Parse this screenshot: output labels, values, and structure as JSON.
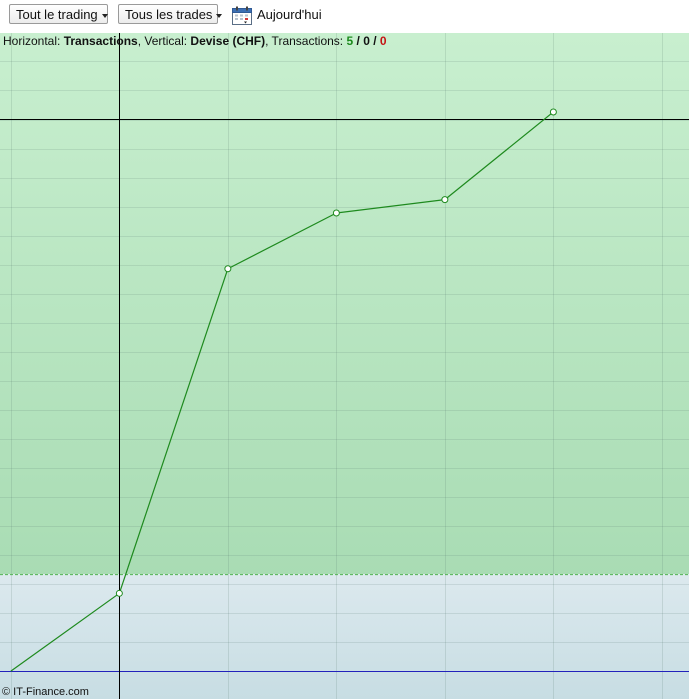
{
  "toolbar": {
    "scope_dropdown": "Tout le trading",
    "trades_dropdown": "Tous les trades",
    "today_label": "Aujourd'hui",
    "today_icon": "calendar-icon"
  },
  "info": {
    "horizontal_label": "Horizontal: ",
    "horizontal_value": "Transactions",
    "vertical_label": ", Vertical: ",
    "vertical_value": "Devise (CHF)",
    "transactions_label": ", Transactions: ",
    "count_total": "5",
    "sep1": " / ",
    "count_neutral": "0",
    "sep2": " / ",
    "count_loss": "0"
  },
  "footer": {
    "copyright": "© IT-Finance.com"
  },
  "colors": {
    "profit_zone_top": "#c8efcf",
    "profit_zone_bottom": "#a9dcb4",
    "neutral_zone_top": "#dce9ee",
    "neutral_zone_bottom": "#c7dde3",
    "line": "#1e8a1e",
    "baseline": "#2222bb"
  },
  "chart_data": {
    "type": "line",
    "title": "",
    "xlabel": "Transactions",
    "ylabel": "Devise (CHF)",
    "x": [
      0,
      1,
      2,
      3,
      4,
      5
    ],
    "values": [
      0,
      13.4,
      69.3,
      78.9,
      81.2,
      96.3
    ],
    "markers_from_index": 1,
    "xlim": [
      -0.1,
      6.25
    ],
    "ylim": [
      -4.8,
      109.9
    ],
    "baseline_value": 0,
    "profit_threshold": 16.7,
    "grid": true,
    "legend": "none"
  }
}
